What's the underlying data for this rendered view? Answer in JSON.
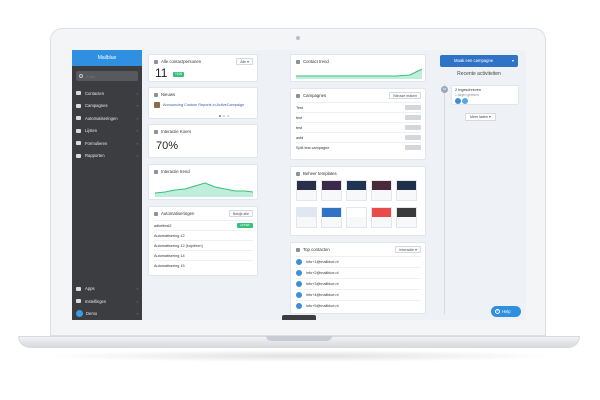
{
  "brand": "Mailblue",
  "search": {
    "placeholder": "Zoek"
  },
  "nav": [
    {
      "label": "Contacten",
      "icon": "contacts-icon"
    },
    {
      "label": "Campagnes",
      "icon": "envelope-icon"
    },
    {
      "label": "Automatiseringen",
      "icon": "automation-icon"
    },
    {
      "label": "Lijsten",
      "icon": "list-icon"
    },
    {
      "label": "Formulieren",
      "icon": "form-icon"
    },
    {
      "label": "Rapporten",
      "icon": "chart-icon"
    }
  ],
  "nav_bottom": [
    {
      "label": "Apps",
      "icon": "apps-icon"
    },
    {
      "label": "Instellingen",
      "icon": "gear-icon"
    },
    {
      "label": "Demo",
      "icon": "avatar"
    }
  ],
  "contacts_card": {
    "title": "Alle contactpersonen",
    "value": "11",
    "badge": "+100",
    "filter": "Alle"
  },
  "trend_card": {
    "title": "Contact trend"
  },
  "news_card": {
    "title": "Nieuws",
    "item": "Announcing Custom Reports in ActiveCampaign"
  },
  "interaction_rate": {
    "title": "Interactie Koers",
    "value": "70%"
  },
  "interaction_trend": {
    "title": "Interactie trend"
  },
  "automations": {
    "title": "Automatiseringen",
    "button": "Bekijk alle",
    "rows": [
      {
        "name": "adbeltest2",
        "status": "ACTIEF"
      },
      {
        "name": "Automatisering 12",
        "status": ""
      },
      {
        "name": "Automatisering 12 (kopiëren)",
        "status": ""
      },
      {
        "name": "Automatisering 14",
        "status": ""
      },
      {
        "name": "Automatisering 15",
        "status": ""
      }
    ]
  },
  "campaigns": {
    "title": "Campagnes",
    "button": "Nieuwe maken",
    "rows": [
      {
        "name": "Test"
      },
      {
        "name": "test"
      },
      {
        "name": "test"
      },
      {
        "name": "asfd"
      },
      {
        "name": "Split test campagne"
      }
    ]
  },
  "templates": {
    "title": "Beheer templates"
  },
  "top_contacts": {
    "title": "Top contacten",
    "filter": "Interactie",
    "rows": [
      {
        "email": "info+1@mailblue.nl"
      },
      {
        "email": "info+2@mailblue.nl"
      },
      {
        "email": "info+3@mailblue.nl"
      },
      {
        "email": "info+4@mailblue.nl"
      },
      {
        "email": "info+5@mailblue.nl"
      }
    ]
  },
  "cta": {
    "label": "Maak een campagne"
  },
  "recent": {
    "title": "Recente activiteiten",
    "badge": "16",
    "item": {
      "title": "2 Ingeschreven",
      "sub": "1 dagen geleden"
    },
    "more": "Meer laden"
  },
  "help": {
    "label": "Help"
  },
  "colors": {
    "accent": "#2f8fe0",
    "sidebar": "#3b3d40",
    "success": "#39c07a",
    "cta": "#2f73c7"
  }
}
